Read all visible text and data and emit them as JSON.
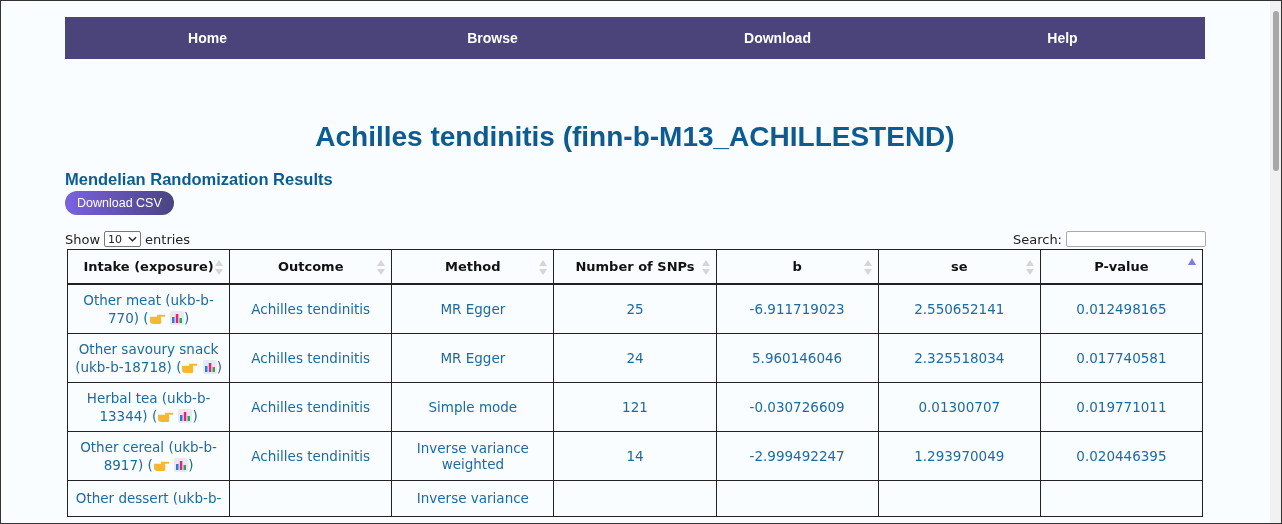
{
  "nav": [
    {
      "label": "Home"
    },
    {
      "label": "Browse"
    },
    {
      "label": "Download"
    },
    {
      "label": "Help"
    }
  ],
  "title": "Achilles tendinitis (finn-b-M13_ACHILLESTEND)",
  "section_title": "Mendelian Randomization Results",
  "download_button": "Download CSV",
  "length": {
    "before": "Show",
    "value": "10",
    "after": "entries"
  },
  "search": {
    "label": "Search:"
  },
  "table": {
    "columns": [
      {
        "label": "Intake (exposure)",
        "sorted": false
      },
      {
        "label": "Outcome",
        "sorted": false
      },
      {
        "label": "Method",
        "sorted": false
      },
      {
        "label": "Number of SNPs",
        "sorted": false
      },
      {
        "label": "b",
        "sorted": false
      },
      {
        "label": "se",
        "sorted": false
      },
      {
        "label": "P-value",
        "sorted": true
      }
    ],
    "rows": [
      {
        "intake": {
          "name": "Other meat (ukb-b-770)",
          "open": "(",
          "close": ")"
        },
        "outcome": "Achilles tendinitis",
        "method": "MR Egger",
        "snps": "25",
        "b": "-6.911719023",
        "se": "2.550652141",
        "p_value": "0.012498165"
      },
      {
        "intake": {
          "name": "Other savoury snack (ukb-b-18718)",
          "open": "(",
          "close": ")"
        },
        "outcome": "Achilles tendinitis",
        "method": "MR Egger",
        "snps": "24",
        "b": "5.960146046",
        "se": "2.325518034",
        "p_value": "0.017740581"
      },
      {
        "intake": {
          "name": "Herbal tea (ukb-b-13344)",
          "open": "(",
          "close": ")"
        },
        "outcome": "Achilles tendinitis",
        "method": "Simple mode",
        "snps": "121",
        "b": "-0.030726609",
        "se": "0.01300707",
        "p_value": "0.019771011"
      },
      {
        "intake": {
          "name": "Other cereal (ukb-b-8917)",
          "open": "(",
          "close": ")"
        },
        "outcome": "Achilles tendinitis",
        "method": "Inverse variance weighted",
        "snps": "14",
        "b": "-2.999492247",
        "se": "1.293970049",
        "p_value": "0.020446395"
      },
      {
        "intake": {
          "name": "Other dessert (ukb-b-"
        },
        "method": "Inverse variance"
      }
    ]
  }
}
